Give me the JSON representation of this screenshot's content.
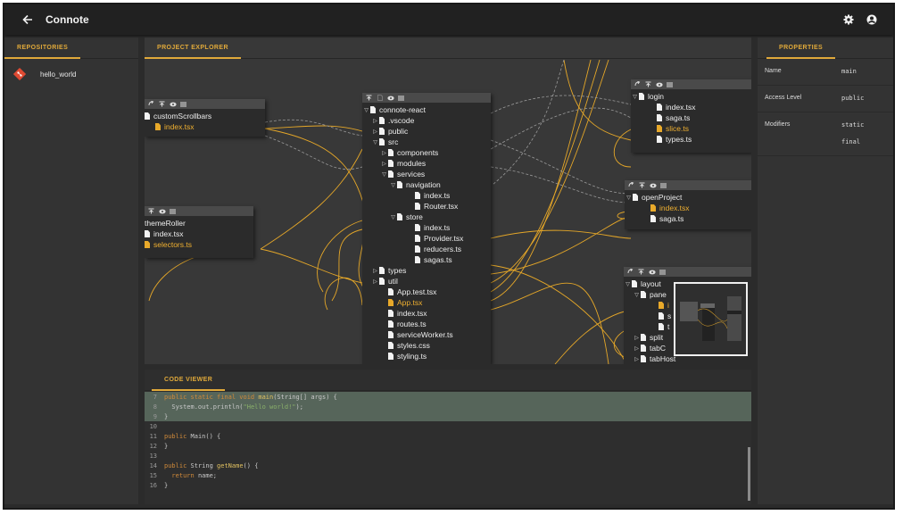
{
  "app": {
    "title": "Connote"
  },
  "repositories": {
    "tab_label": "REPOSITORIES",
    "items": [
      {
        "label": "hello_world"
      }
    ]
  },
  "explorer": {
    "tab_label": "PROJECT EXPLORER",
    "nodes": {
      "customScrollbars": {
        "title": "customScrollbars",
        "files": [
          "index.tsx"
        ]
      },
      "themeRoller": {
        "title": "themeRoller",
        "files": [
          "index.tsx",
          "selectors.ts"
        ]
      },
      "main": {
        "rows": [
          "connote-react",
          ".vscode",
          "public",
          "src",
          "components",
          "modules",
          "services",
          "navigation",
          "index.ts",
          "Router.tsx",
          "store",
          "index.ts",
          "Provider.tsx",
          "reducers.ts",
          "sagas.ts",
          "types",
          "util",
          "App.test.tsx",
          "App.tsx",
          "index.tsx",
          "routes.ts",
          "serviceWorker.ts",
          "styles.css",
          "styling.ts"
        ]
      },
      "login": {
        "rows": [
          "login",
          "index.tsx",
          "saga.ts",
          "slice.ts",
          "types.ts"
        ]
      },
      "openProject": {
        "rows": [
          "openProject",
          "index.tsx",
          "saga.ts"
        ]
      },
      "layout": {
        "rows": [
          "layout",
          "pane",
          "i",
          "s",
          "t",
          "split",
          "tabC",
          "tabHost"
        ]
      }
    }
  },
  "properties": {
    "tab_label": "PROPERTIES",
    "rows": [
      {
        "name": "Name",
        "values": [
          "main"
        ]
      },
      {
        "name": "Access Level",
        "values": [
          "public"
        ]
      },
      {
        "name": "Modifiers",
        "values": [
          "static",
          "final"
        ]
      }
    ]
  },
  "code_viewer": {
    "tab_label": "CODE VIEWER",
    "line_numbers": [
      "7",
      "8",
      "9",
      "10",
      "11",
      "12",
      "13",
      "14",
      "15",
      "16"
    ],
    "tokens": {
      "l7_kw": "public static final void ",
      "l7_fn": "main",
      "l7_rest": "(String[] args) {",
      "l8_pre": "  System.out.println(",
      "l8_str": "\"Hello world!\"",
      "l8_post": ");",
      "l9": "}",
      "l11_kw": "public ",
      "l11_rest": "Main() {",
      "l12": "}",
      "l14_kw": "public ",
      "l14_type": "String ",
      "l14_fn": "getName",
      "l14_rest": "() {",
      "l15_kw": "  return ",
      "l15_rest": "name;",
      "l16": "}"
    }
  },
  "colors": {
    "accent": "#e0a93a",
    "background": "#2b2b2b",
    "highlight_line": "#56655a"
  }
}
